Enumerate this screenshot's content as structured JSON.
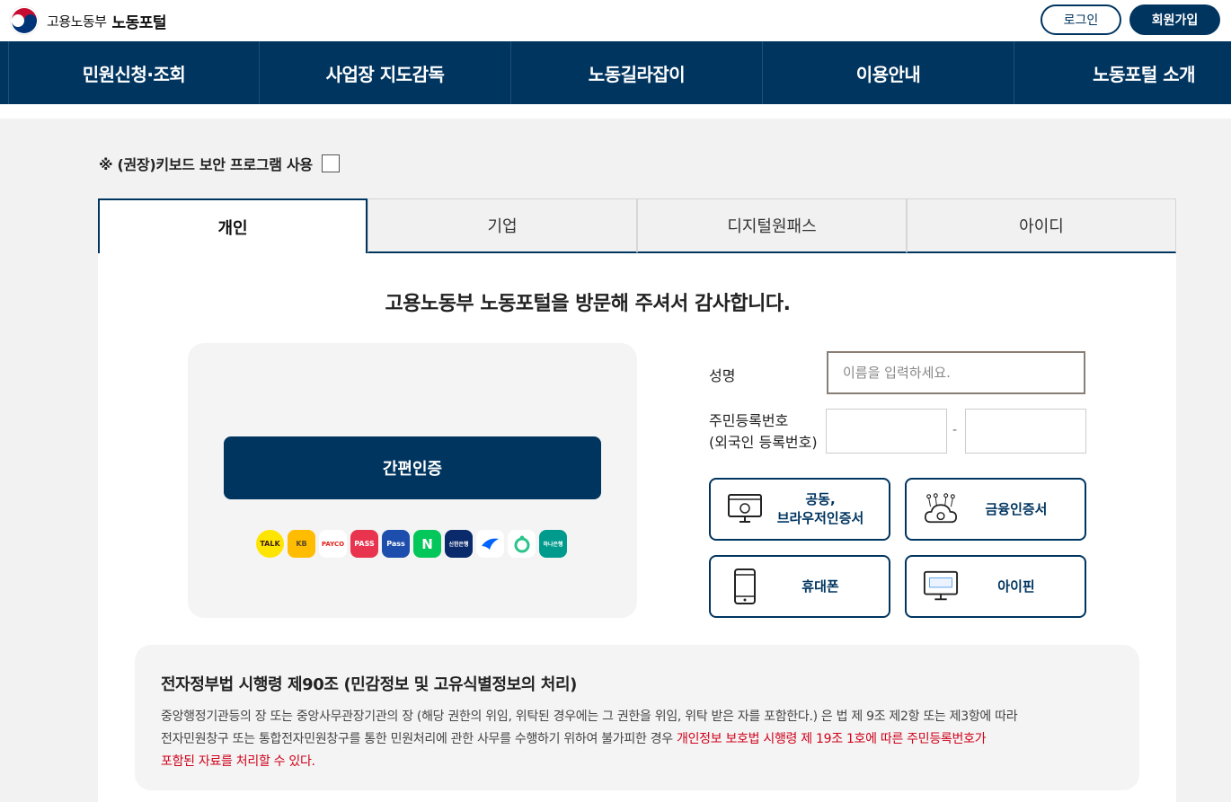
{
  "header": {
    "org_name": "고용노동부",
    "portal_name": "노동포털",
    "login_label": "로그인",
    "join_label": "회원가입"
  },
  "nav": {
    "items": [
      "민원신청·조회",
      "사업장 지도감독",
      "노동길라잡이",
      "이용안내",
      "노동포털 소개"
    ]
  },
  "keyboard_security": {
    "label": "※ (권장)키보드 보안 프로그램 사용",
    "checked": false
  },
  "tabs": {
    "items": [
      "개인",
      "기업",
      "디지털원패스",
      "아이디"
    ],
    "active": "개인"
  },
  "main": {
    "welcome": "고용노동부 노동포털을 방문해 주셔서 감사합니다.",
    "simple_auth_label": "간편인증",
    "providers": [
      {
        "name": "kakao",
        "label": "TALK"
      },
      {
        "name": "kb",
        "label": "KB"
      },
      {
        "name": "payco",
        "label": "PAYCO"
      },
      {
        "name": "pass",
        "label": "PASS"
      },
      {
        "name": "samsung-pass",
        "label": "Pass"
      },
      {
        "name": "naver",
        "label": "N"
      },
      {
        "name": "shinhan",
        "label": "신한은행"
      },
      {
        "name": "toss",
        "label": ""
      },
      {
        "name": "banksalad",
        "label": ""
      },
      {
        "name": "hana",
        "label": "하나은행"
      }
    ],
    "name_label": "성명",
    "name_placeholder": "이름을 입력하세요.",
    "rrn_label_line1": "주민등록번호",
    "rrn_label_line2": "(외국인 등록번호)",
    "rrn_separator": "-",
    "cert_buttons": {
      "joint_line1": "공동,",
      "joint_line2": "브라우저인증서",
      "financial": "금융인증서",
      "mobile": "휴대폰",
      "ipin": "아이핀"
    }
  },
  "notice": {
    "title": "전자정부법 시행령 제90조 (민감정보 및 고유식별정보의 처리)",
    "body_line1": "중앙행정기관등의 장 또는 중앙사무관장기관의 장 (해당 권한의 위임, 위탁된 경우에는 그 권한을 위임, 위탁 받은 자를 포함한다.) 은 법 제 9조 제2항 또는 제3항에 따라",
    "body_line2_normal": "전자민원창구 또는 통합전자민원창구를 통한 민원처리에 관한 사무를 수행하기 위하여 불가피한 경우 ",
    "body_line2_red": "개인정보 보호법 시행령 제 19조 1호에 따른 주민등록번호가",
    "body_line3_red": "포함된 자료를 처리할 수 있다."
  },
  "colors": {
    "primary": "#003560",
    "notice_red": "#d0021b"
  }
}
